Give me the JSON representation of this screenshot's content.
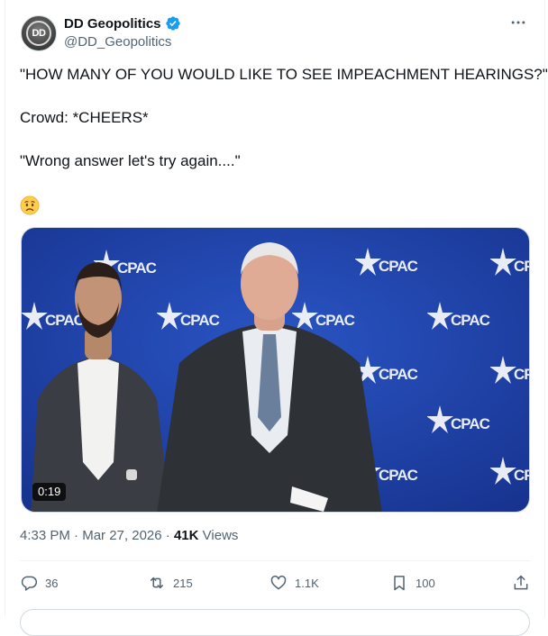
{
  "author": {
    "display_name": "DD Geopolitics",
    "handle": "@DD_Geopolitics",
    "avatar_text": "DD",
    "verified": true,
    "verified_color": "#1d9bf0"
  },
  "tweet": {
    "line1": "\"HOW MANY OF YOU WOULD LIKE TO SEE IMPEACHMENT HEARINGS?\"",
    "line2": "Crowd: *CHEERS*",
    "line3": "\"Wrong answer let's try again....\"",
    "emoji": "worried-face"
  },
  "media": {
    "type": "video",
    "duration": "0:19",
    "backdrop_text": "CPAC",
    "backdrop_color": "#1c3fa6"
  },
  "meta": {
    "time": "4:33 PM",
    "separator": "·",
    "date": "Mar 27, 2026",
    "views_count": "41K",
    "views_label": "Views"
  },
  "actions": {
    "replies": "36",
    "reposts": "215",
    "likes": "1.1K",
    "bookmarks": "100"
  },
  "colors": {
    "text_primary": "#0f1419",
    "text_secondary": "#536471",
    "border": "#eff3f4"
  }
}
